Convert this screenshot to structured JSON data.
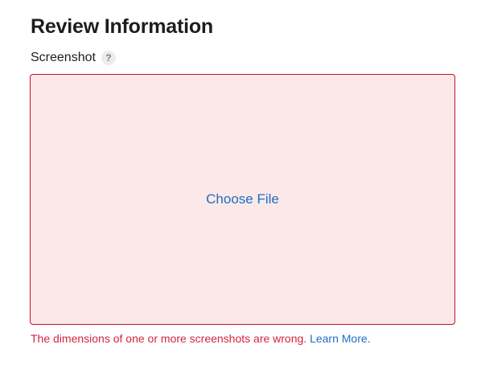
{
  "section": {
    "title": "Review Information"
  },
  "screenshot_field": {
    "label": "Screenshot",
    "help_icon_glyph": "?",
    "help_icon_name": "question-mark-icon",
    "dropzone": {
      "action_label": "Choose File",
      "state": "error"
    },
    "error": {
      "message": "The dimensions of one or more screenshots are wrong.",
      "link_label": "Learn More",
      "trailing": "."
    }
  },
  "colors": {
    "error_border": "#c8102e",
    "error_background": "#fbe8e9",
    "error_text": "#d4253f",
    "link": "#1d6fc4"
  }
}
